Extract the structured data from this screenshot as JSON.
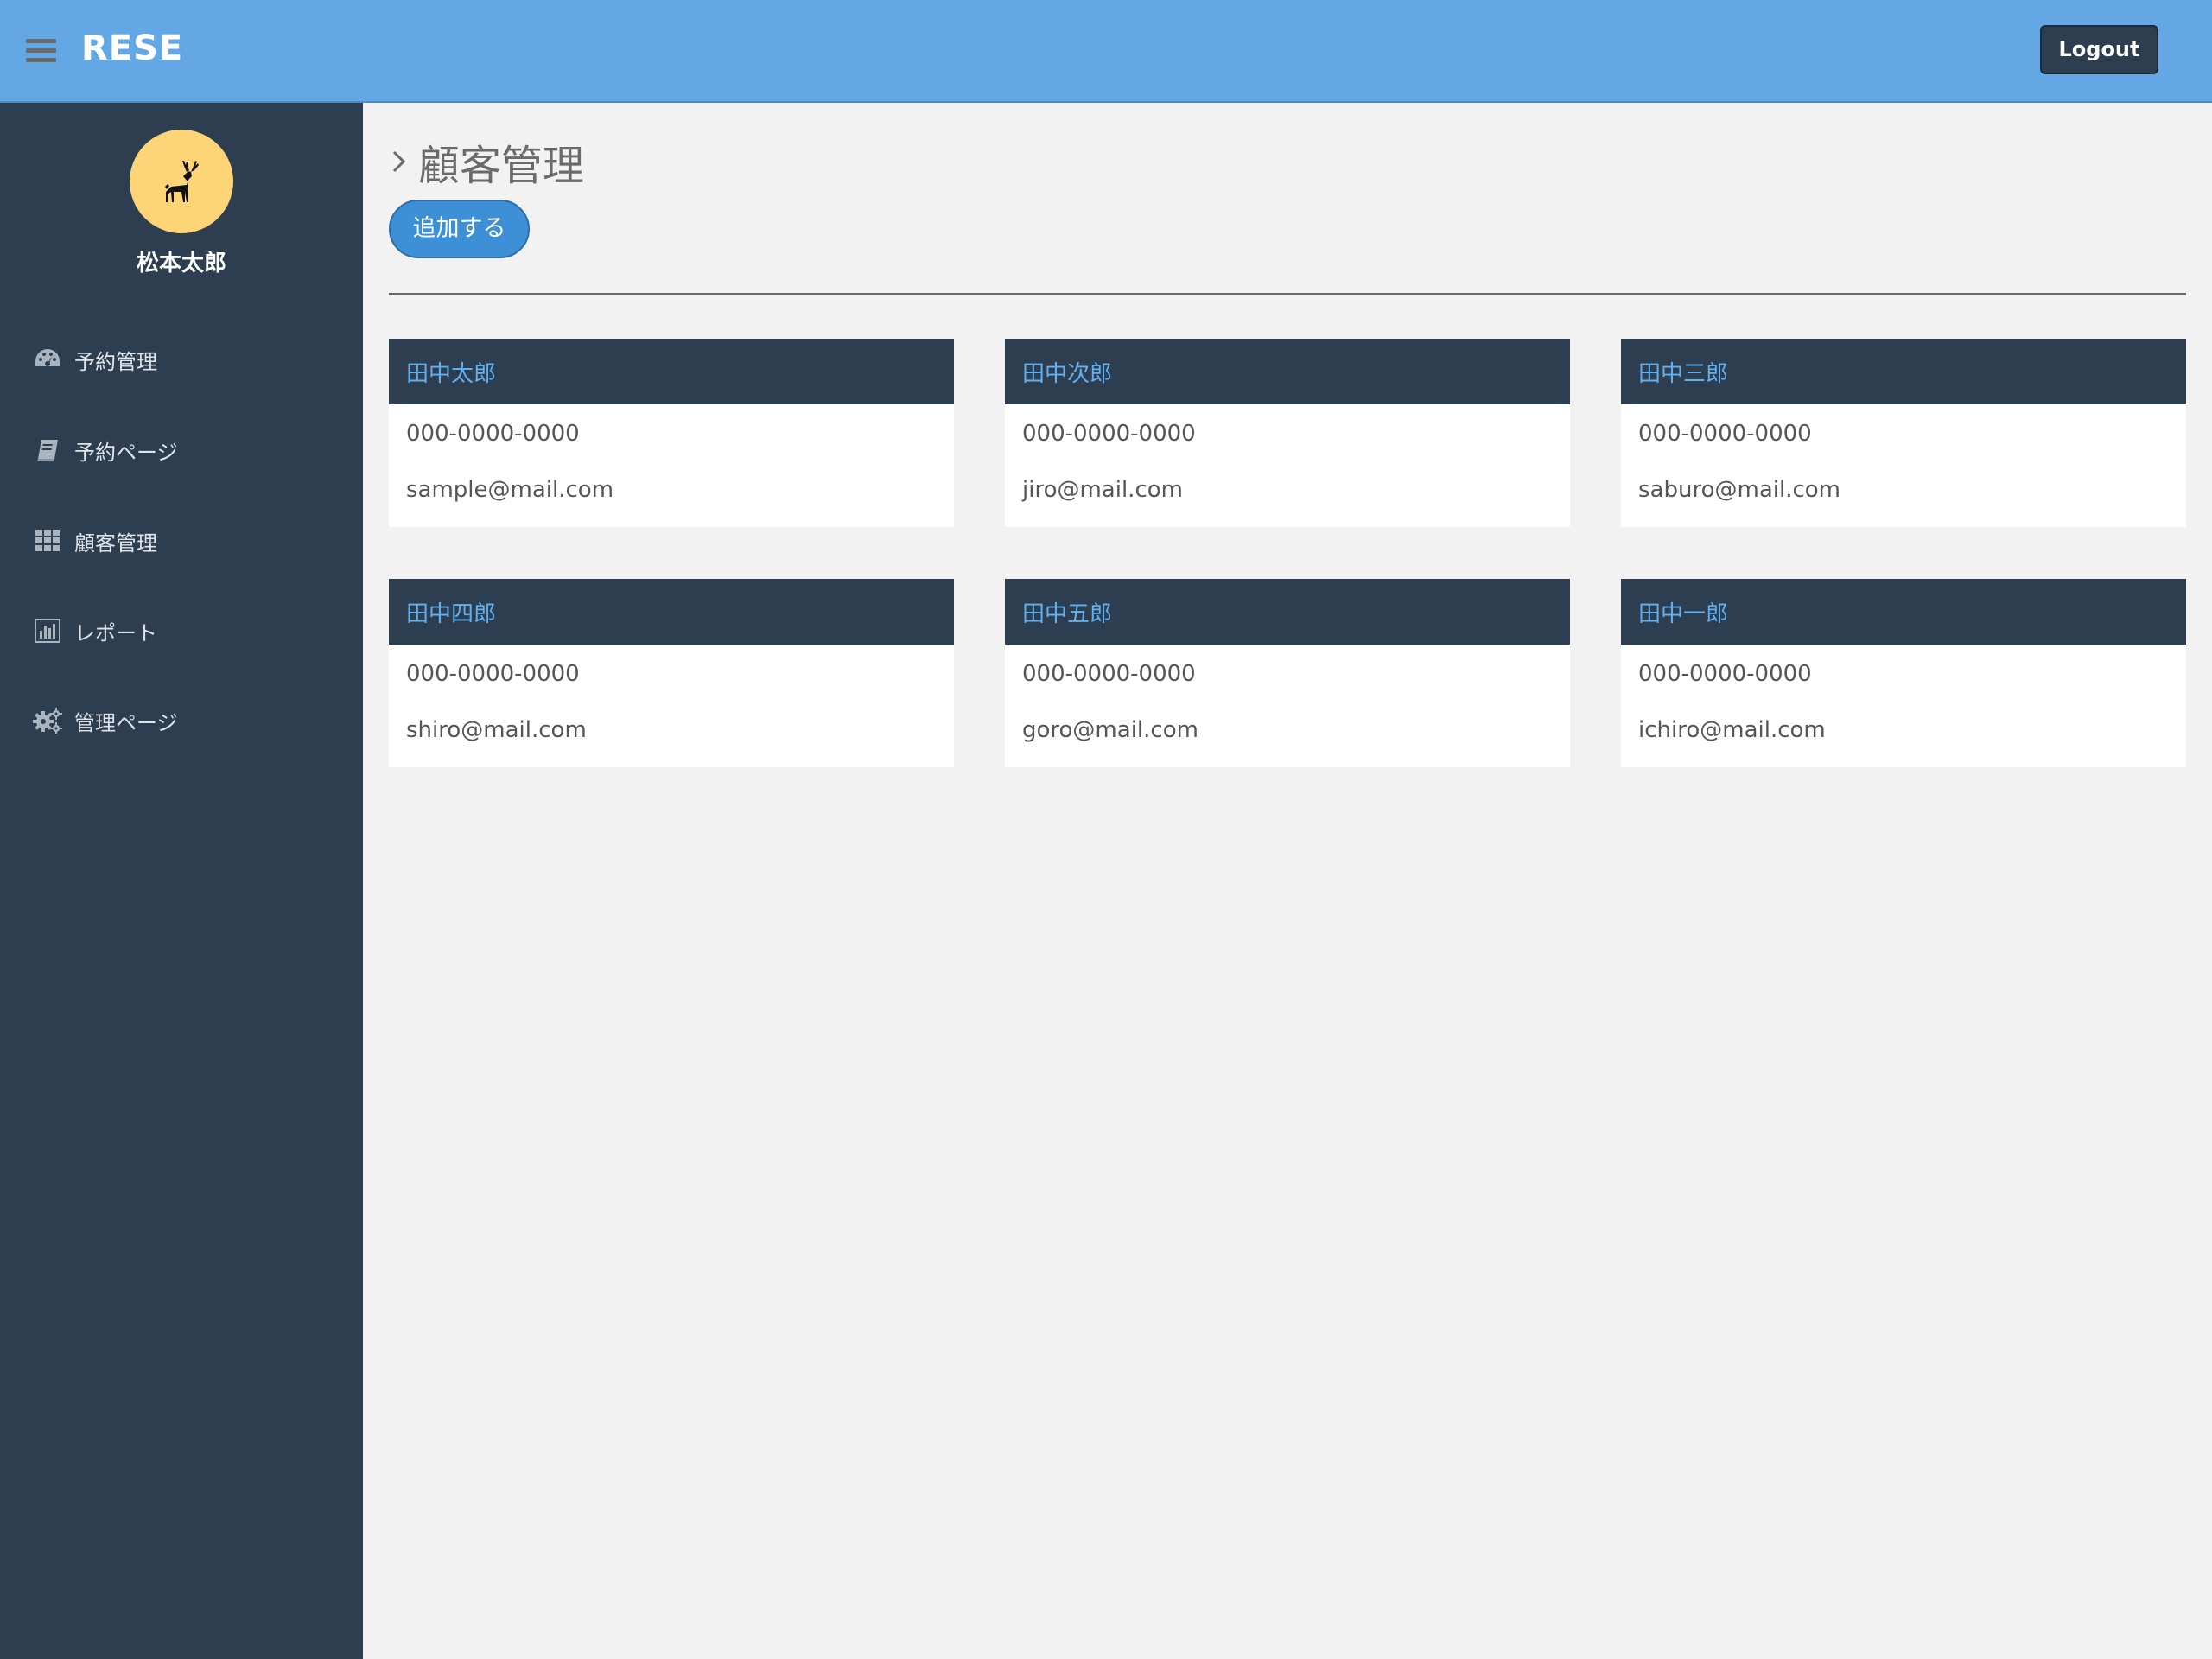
{
  "header": {
    "brand": "RESE",
    "logout_label": "Logout"
  },
  "sidebar": {
    "user_name": "松本太郎",
    "items": [
      {
        "label": "予約管理",
        "icon": "dashboard-icon"
      },
      {
        "label": "予約ページ",
        "icon": "book-icon"
      },
      {
        "label": "顧客管理",
        "icon": "grid-icon"
      },
      {
        "label": "レポート",
        "icon": "bar-chart-icon"
      },
      {
        "label": "管理ページ",
        "icon": "gears-icon"
      }
    ]
  },
  "main": {
    "title": "顧客管理",
    "add_label": "追加する",
    "customers": [
      {
        "name": "田中太郎",
        "phone": "000-0000-0000",
        "email": "sample@mail.com"
      },
      {
        "name": "田中次郎",
        "phone": "000-0000-0000",
        "email": "jiro@mail.com"
      },
      {
        "name": "田中三郎",
        "phone": "000-0000-0000",
        "email": "saburo@mail.com"
      },
      {
        "name": "田中四郎",
        "phone": "000-0000-0000",
        "email": "shiro@mail.com"
      },
      {
        "name": "田中五郎",
        "phone": "000-0000-0000",
        "email": "goro@mail.com"
      },
      {
        "name": "田中一郎",
        "phone": "000-0000-0000",
        "email": "ichiro@mail.com"
      }
    ]
  },
  "colors": {
    "header": "#63a8e4",
    "sidebar": "#2c3e50",
    "accent": "#3d8fd6",
    "avatar": "#fdd476",
    "card_title": "#63b0f0"
  }
}
